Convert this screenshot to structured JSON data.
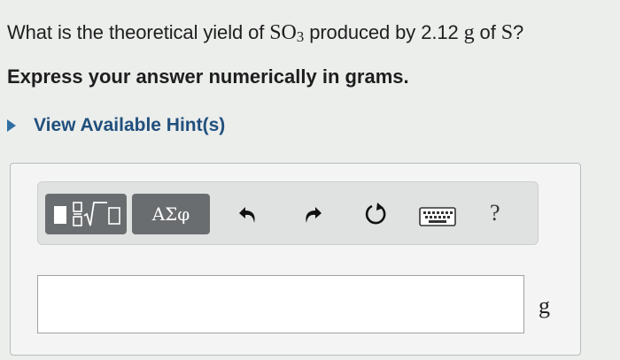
{
  "question": {
    "prefix": "What is the theoretical yield of ",
    "compound_base": "SO",
    "compound_sub": "3",
    "middle": " produced by 2.12 ",
    "mass_unit": "g",
    "of_text": " of ",
    "element": "S",
    "suffix": "?"
  },
  "instruction": "Express your answer numerically in grams.",
  "hint": {
    "label": "View Available Hint(s)"
  },
  "toolbar": {
    "templates_icon": "templates-sqrt-icon",
    "greek_label": "ΑΣφ",
    "undo_icon": "undo-arrow-icon",
    "redo_icon": "redo-arrow-icon",
    "reset_icon": "reset-icon",
    "keyboard_icon": "keyboard-icon",
    "help_label": "?"
  },
  "answer": {
    "value": "",
    "unit": "g"
  }
}
